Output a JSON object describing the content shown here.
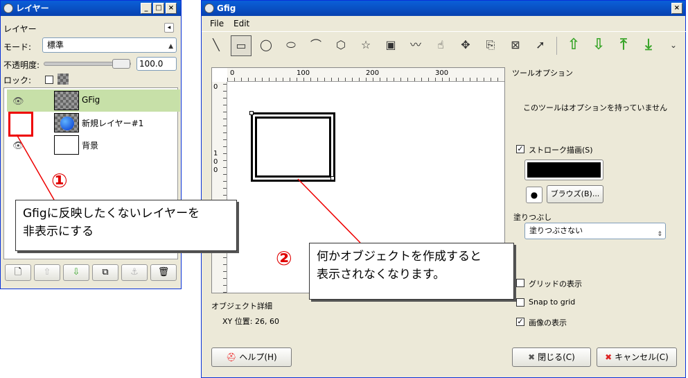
{
  "layers_window": {
    "title": "レイヤー",
    "panel_label": "レイヤー",
    "mode_label": "モード:",
    "mode_value": "標準",
    "opacity_label": "不透明度:",
    "opacity_value": "100.0",
    "lock_label": "ロック:",
    "layers": [
      {
        "name": "GFig",
        "visible": true,
        "selected": true
      },
      {
        "name": "新規レイヤー#1",
        "visible": false,
        "selected": false
      },
      {
        "name": "背景",
        "visible": true,
        "selected": false
      }
    ],
    "bottom_buttons": [
      "new-layer",
      "raise-layer",
      "lower-layer",
      "duplicate-layer",
      "anchor-layer",
      "delete-layer"
    ]
  },
  "gfig_window": {
    "title": "Gfig",
    "menu": [
      "File",
      "Edit"
    ],
    "tools": [
      "line",
      "rectangle",
      "circle",
      "ellipse",
      "arc",
      "polygon",
      "star",
      "spiral",
      "bezier",
      "move-object",
      "move-point",
      "copy-object",
      "delete-object",
      "select"
    ],
    "ruler_labels": [
      "0",
      "100",
      "200",
      "300"
    ],
    "ruler_v_labels": [
      "0",
      "1",
      "0",
      "0"
    ],
    "tool_options_title": "ツールオプション",
    "tool_options_message": "このツールはオプションを持っていません",
    "stroke_label": "ストローク描画(S)",
    "stroke_checked": true,
    "stroke_color": "#000000",
    "browse_label": "ブラウズ(B)...",
    "fill_label": "塗りつぶし",
    "fill_value": "塗りつぶさない",
    "show_grid_label": "グリッドの表示",
    "show_grid_checked": false,
    "snap_to_grid_label": "Snap to grid",
    "snap_checked": false,
    "show_image_label": "画像の表示",
    "show_image_checked": true,
    "object_details_label": "オブジェクト詳細",
    "xy_position": "XY 位置:  26, 60",
    "help_label": "ヘルプ(H)",
    "close_label": "閉じる(C)",
    "cancel_label": "キャンセル(C)"
  },
  "annotations": {
    "num1": "①",
    "num2": "②",
    "callout1_line1": "Gfigに反映したくないレイヤーを",
    "callout1_line2": "非表示にする",
    "callout2_line1": "何かオブジェクトを作成すると",
    "callout2_line2": "表示されなくなります。",
    "accent_color": "#e00000"
  }
}
